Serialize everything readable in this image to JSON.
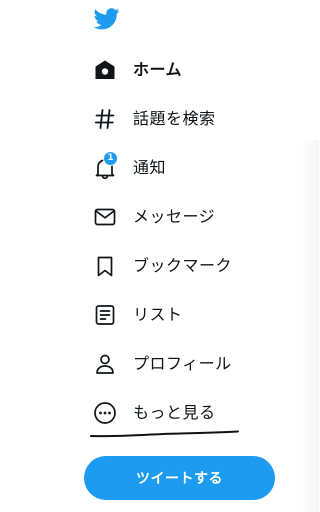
{
  "app": {
    "logo_icon": "twitter-bird-icon",
    "accent_color": "#1d9bf0"
  },
  "nav": {
    "items": [
      {
        "label": "ホーム",
        "icon": "home-icon",
        "active": true
      },
      {
        "label": "話題を検索",
        "icon": "hashtag-icon",
        "active": false
      },
      {
        "label": "通知",
        "icon": "bell-icon",
        "active": false,
        "badge": "1"
      },
      {
        "label": "メッセージ",
        "icon": "envelope-icon",
        "active": false
      },
      {
        "label": "ブックマーク",
        "icon": "bookmark-icon",
        "active": false
      },
      {
        "label": "リスト",
        "icon": "list-icon",
        "active": false
      },
      {
        "label": "プロフィール",
        "icon": "person-icon",
        "active": false
      },
      {
        "label": "もっと見る",
        "icon": "more-circle-icon",
        "active": false
      }
    ]
  },
  "tweet_button": {
    "label": "ツイートする"
  }
}
